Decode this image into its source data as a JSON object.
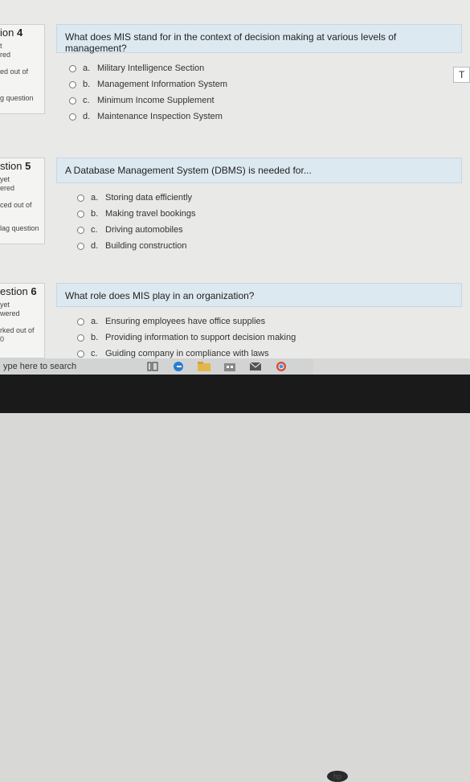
{
  "questions": [
    {
      "info": {
        "number_prefix": "ion",
        "number": "4",
        "status": "t",
        "status2": "red",
        "marks": "ed out of",
        "flag": "g question"
      },
      "text": "What does MIS stand for in the context of decision making at various levels of management?",
      "answers": [
        {
          "letter": "a.",
          "text": "Military Intelligence Section"
        },
        {
          "letter": "b.",
          "text": "Management Information System"
        },
        {
          "letter": "c.",
          "text": "Minimum Income Supplement"
        },
        {
          "letter": "d.",
          "text": "Maintenance Inspection System"
        }
      ]
    },
    {
      "info": {
        "number_prefix": "stion",
        "number": "5",
        "status": "yet",
        "status2": "ered",
        "marks": "ced out of",
        "flag": "lag question"
      },
      "text": "A Database Management System (DBMS) is needed for...",
      "answers": [
        {
          "letter": "a.",
          "text": "Storing data efficiently"
        },
        {
          "letter": "b.",
          "text": "Making travel bookings"
        },
        {
          "letter": "c.",
          "text": "Driving automobiles"
        },
        {
          "letter": "d.",
          "text": "Building construction"
        }
      ]
    },
    {
      "info": {
        "number_prefix": "estion",
        "number": "6",
        "status": "yet",
        "status2": "wered",
        "marks": "rked out of",
        "marks2": "0"
      },
      "text": "What role does MIS play in an organization?",
      "answers": [
        {
          "letter": "a.",
          "text": "Ensuring employees have office supplies"
        },
        {
          "letter": "b.",
          "text": "Providing information to support decision making"
        },
        {
          "letter": "c.",
          "text": "Guiding company in compliance with laws"
        }
      ]
    }
  ],
  "right_edge_text": "T",
  "taskbar": {
    "search_placeholder": "ype here to search",
    "icons": [
      "task-view-icon",
      "edge-icon",
      "file-explorer-icon",
      "store-icon",
      "mail-icon",
      "chrome-icon"
    ]
  },
  "bezel_logo": "hp"
}
